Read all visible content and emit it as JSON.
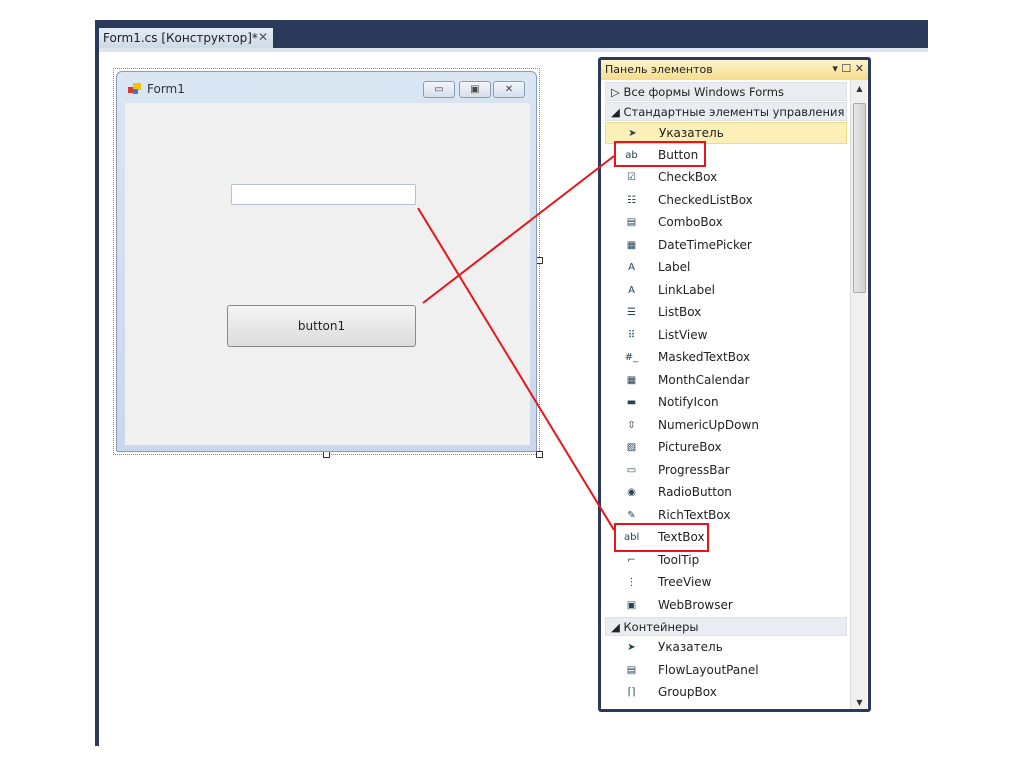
{
  "tab": {
    "label": "Form1.cs [Конструктор]*",
    "close": "✕"
  },
  "form": {
    "title": "Form1",
    "minimize": "▭",
    "maximize": "▣",
    "close": "✕",
    "button_text": "button1",
    "textbox_value": ""
  },
  "panel": {
    "title": "Панель элементов",
    "controls": "▾ ☐ ✕",
    "groups": [
      "Все формы Windows Forms",
      "Стандартные элементы управления",
      "Контейнеры"
    ],
    "group_arrows": [
      "▷",
      "◢",
      "◢"
    ],
    "standard_items": [
      {
        "label": "Указатель",
        "icon": "➤"
      },
      {
        "label": "Button",
        "icon": "ab"
      },
      {
        "label": "CheckBox",
        "icon": "☑"
      },
      {
        "label": "CheckedListBox",
        "icon": "☷"
      },
      {
        "label": "ComboBox",
        "icon": "▤"
      },
      {
        "label": "DateTimePicker",
        "icon": "▦"
      },
      {
        "label": "Label",
        "icon": "A"
      },
      {
        "label": "LinkLabel",
        "icon": "A"
      },
      {
        "label": "ListBox",
        "icon": "☰"
      },
      {
        "label": "ListView",
        "icon": "⠿"
      },
      {
        "label": "MaskedTextBox",
        "icon": "#_"
      },
      {
        "label": "MonthCalendar",
        "icon": "▦"
      },
      {
        "label": "NotifyIcon",
        "icon": "▬"
      },
      {
        "label": "NumericUpDown",
        "icon": "⇳"
      },
      {
        "label": "PictureBox",
        "icon": "▨"
      },
      {
        "label": "ProgressBar",
        "icon": "▭"
      },
      {
        "label": "RadioButton",
        "icon": "◉"
      },
      {
        "label": "RichTextBox",
        "icon": "✎"
      },
      {
        "label": "TextBox",
        "icon": "abl"
      },
      {
        "label": "ToolTip",
        "icon": "⌐"
      },
      {
        "label": "TreeView",
        "icon": "⋮"
      },
      {
        "label": "WebBrowser",
        "icon": "▣"
      }
    ],
    "container_items": [
      {
        "label": "Указатель",
        "icon": "➤"
      },
      {
        "label": "FlowLayoutPanel",
        "icon": "▤"
      },
      {
        "label": "GroupBox",
        "icon": "⌈⌉"
      }
    ]
  },
  "colors": {
    "accent": "#2b3a5a",
    "highlight": "#e8141b",
    "selected": "#fcefb8"
  }
}
